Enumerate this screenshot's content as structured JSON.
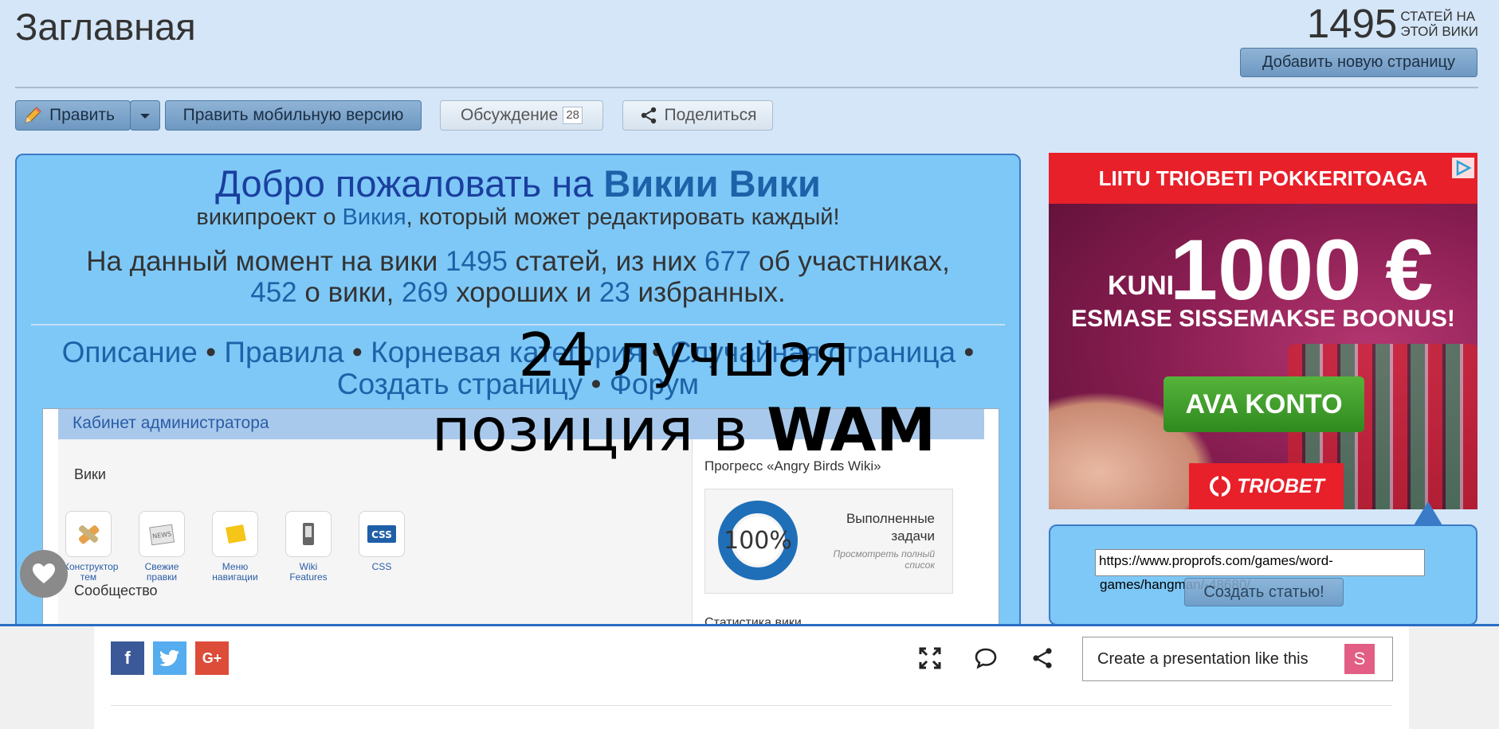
{
  "header": {
    "title": "Заглавная",
    "article_count": "1495",
    "article_count_label_line1": "СТАТЕЙ НА",
    "article_count_label_line2": "ЭТОЙ ВИКИ",
    "add_page_label": "Добавить новую страницу"
  },
  "toolbar": {
    "edit_label": "Править",
    "edit_mobile_label": "Править мобильную версию",
    "talk_label": "Обсуждение",
    "talk_count": "28",
    "share_label": "Поделиться"
  },
  "welcome": {
    "title_prefix": "Добро пожаловать на",
    "title_wiki": "Викии Вики",
    "sub_prefix": "википроект о",
    "sub_link": "Викия",
    "sub_suffix": ", который может редактировать каждый!",
    "stats_1": "На данный момент на вики",
    "stats_articles": "1495",
    "stats_2": "статей, из них",
    "stats_members": "677",
    "stats_3": "об участниках,",
    "stats_about": "452",
    "stats_4": "о вики,",
    "stats_good": "269",
    "stats_5": "хороших и",
    "stats_featured": "23",
    "stats_6": "избранных.",
    "links": [
      "Описание",
      "Правила",
      "Корневая категория",
      "Случайная страница",
      "Создать страницу",
      "Форум"
    ],
    "separator": "•"
  },
  "admin": {
    "bar_title": "Кабинет администратора",
    "section_wiki": "Вики",
    "section_community": "Сообщество",
    "icons": [
      {
        "caption_1": "Конструктор",
        "caption_2": "тем",
        "icon": "theme-designer-icon"
      },
      {
        "caption_1": "Свежие",
        "caption_2": "правки",
        "icon": "news-icon"
      },
      {
        "caption_1": "Меню",
        "caption_2": "навигации",
        "icon": "navigation-menu-icon"
      },
      {
        "caption_1": "Wiki Features",
        "caption_2": "",
        "icon": "wiki-features-icon"
      },
      {
        "caption_1": "CSS",
        "caption_2": "",
        "icon": "css-icon"
      }
    ],
    "css_tile_text": "CSS",
    "news_tile_text": "NEWS",
    "progress_title": "Прогресс «Angry Birds Wiki»",
    "progress_value": "100%",
    "progress_label_1": "Выполненные",
    "progress_label_2": "задачи",
    "progress_sub_1": "Просмотреть полный",
    "progress_sub_2": "список",
    "stats_title": "Статистика вики"
  },
  "overlay": {
    "line1": "24  лучшая",
    "line2_prefix": "позиция в",
    "line2_bold": "WAM"
  },
  "ad": {
    "top_text": "LIITU TRIOBETI POKKERITOAGA",
    "kuni": "KUNI",
    "amount": "1000 €",
    "bonus": "ESMASE SISSEMAKSE BOONUS!",
    "cta": "AVA KONTO",
    "brand": "TRIOBET"
  },
  "create": {
    "url_line1": "https://www.proprofs.com/games/word-",
    "url_line2": "games/hangman/-48680/",
    "button_label": "Создать статью!"
  },
  "bottom": {
    "present_label": "Create a presentation like this",
    "present_badge": "S",
    "fb": "f",
    "gp": "G+"
  },
  "colors": {
    "page_bg": "#d4e6f7",
    "panel_bg": "#7ec8f7",
    "link": "#1d62a8",
    "accent_border": "#3a7bc8",
    "ad_red": "#e8202a",
    "ad_green": "#56b33a",
    "present_pink": "#e25e84"
  }
}
